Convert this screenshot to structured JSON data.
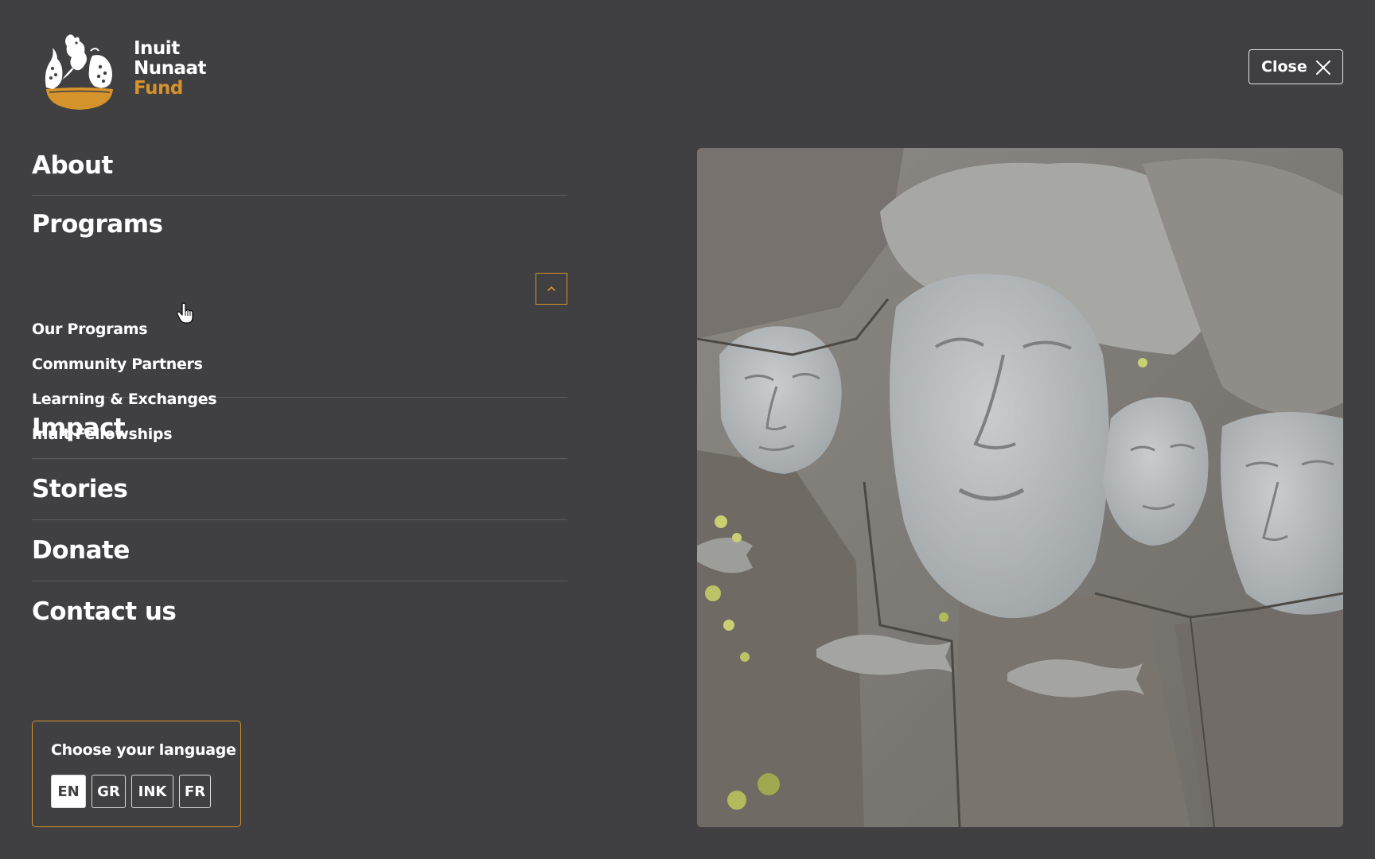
{
  "brand": {
    "line1": "Inuit",
    "line2": "Nunaat",
    "line3": "Fund",
    "accent_color": "#d5932c",
    "logo_icon": "inuit-figures-bowl-logo"
  },
  "header": {
    "close_label": "Close",
    "close_icon": "close-icon"
  },
  "menu": {
    "about": "About",
    "programs": "Programs",
    "programs_expanded": true,
    "programs_toggle_icon": "chevron-up-icon",
    "programs_items": [
      "Our Programs",
      "Community Partners",
      "Learning & Exchanges",
      "Inuit Fellowships"
    ],
    "impact": "Impact",
    "stories": "Stories",
    "donate": "Donate",
    "contact": "Contact us"
  },
  "language": {
    "title": "Choose your language",
    "options": [
      "EN",
      "GR",
      "INK",
      "FR"
    ],
    "selected": "EN"
  },
  "colors": {
    "background": "#403f42",
    "text": "#ffffff",
    "divider": "#5c5b5f"
  }
}
